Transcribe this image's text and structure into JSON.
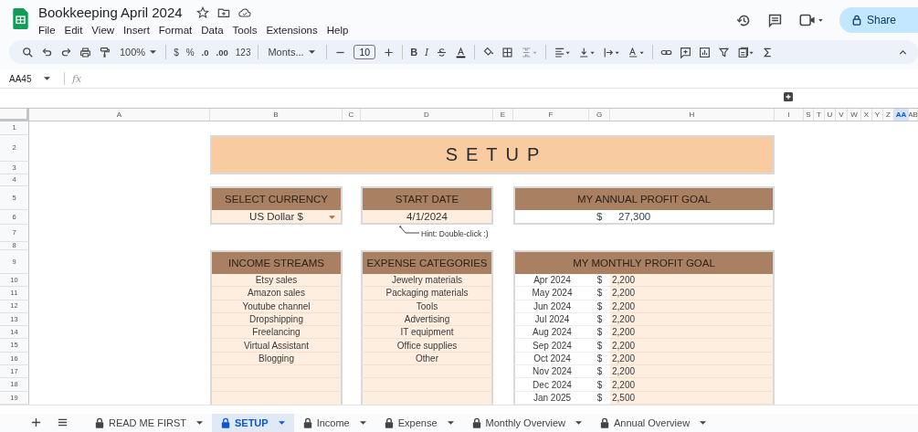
{
  "document": {
    "title": "Bookkeeping April 2024"
  },
  "menu": [
    "File",
    "Edit",
    "View",
    "Insert",
    "Format",
    "Data",
    "Tools",
    "Extensions",
    "Help"
  ],
  "share_button": {
    "label": "Share"
  },
  "toolbar": {
    "zoom": "100%",
    "currency": "$",
    "percent": "%",
    "decrease_decimals": ".0",
    "increase_decimals": ".00",
    "number_format": "123",
    "font": "Monts...",
    "font_size": "10",
    "bold": "B",
    "italic": "I"
  },
  "name_box": "AA45",
  "formula_label": "fx",
  "columns": [
    {
      "label": "A",
      "selected": false
    },
    {
      "label": "B",
      "selected": false
    },
    {
      "label": "C",
      "selected": false
    },
    {
      "label": "D",
      "selected": false
    },
    {
      "label": "E",
      "selected": false
    },
    {
      "label": "F",
      "selected": false
    },
    {
      "label": "G",
      "selected": false
    },
    {
      "label": "H",
      "selected": false
    },
    {
      "label": "I",
      "selected": false
    },
    {
      "label": "S",
      "selected": false
    },
    {
      "label": "T",
      "selected": false
    },
    {
      "label": "U",
      "selected": false
    },
    {
      "label": "V",
      "selected": false
    },
    {
      "label": "W",
      "selected": false
    },
    {
      "label": "X",
      "selected": false
    },
    {
      "label": "Y",
      "selected": false
    },
    {
      "label": "Z",
      "selected": false
    },
    {
      "label": "AA",
      "selected": true
    },
    {
      "label": "AB",
      "selected": false
    }
  ],
  "rows": [
    "1",
    "2",
    "3",
    "4",
    "5",
    "6",
    "7",
    "8",
    "9",
    "10",
    "11",
    "12",
    "13",
    "14",
    "15",
    "16",
    "17",
    "18",
    "19"
  ],
  "setup": {
    "title": "SETUP",
    "currency": {
      "heading": "SELECT CURRENCY",
      "value": "US Dollar $"
    },
    "start_date": {
      "heading": "START DATE",
      "value": "4/1/2024",
      "hint": "Hint: Double-click :)"
    },
    "annual_goal": {
      "heading": "MY ANNUAL PROFIT GOAL",
      "currency_symbol": "$",
      "amount": "27,300"
    },
    "income_streams": {
      "heading": "INCOME STREAMS",
      "items": [
        "Etsy sales",
        "Amazon sales",
        "Youtube channel",
        "Dropshipping",
        "Freelancing",
        "Virtual Assistant",
        "Blogging"
      ]
    },
    "expense_categories": {
      "heading": "EXPENSE CATEGORIES",
      "items": [
        "Jewelry materials",
        "Packaging materials",
        "Tools",
        "Advertising",
        "IT equipment",
        "Office supplies",
        "Other"
      ]
    },
    "monthly_goal": {
      "heading": "MY MONTHLY PROFIT GOAL",
      "rows": [
        {
          "month": "Apr 2024",
          "currency_symbol": "$",
          "amount": "2,200"
        },
        {
          "month": "May 2024",
          "currency_symbol": "$",
          "amount": "2,200"
        },
        {
          "month": "Jun 2024",
          "currency_symbol": "$",
          "amount": "2,200"
        },
        {
          "month": "Jul 2024",
          "currency_symbol": "$",
          "amount": "2,200"
        },
        {
          "month": "Aug 2024",
          "currency_symbol": "$",
          "amount": "2,200"
        },
        {
          "month": "Sep 2024",
          "currency_symbol": "$",
          "amount": "2,200"
        },
        {
          "month": "Oct 2024",
          "currency_symbol": "$",
          "amount": "2,200"
        },
        {
          "month": "Nov 2024",
          "currency_symbol": "$",
          "amount": "2,200"
        },
        {
          "month": "Dec 2024",
          "currency_symbol": "$",
          "amount": "2,200"
        },
        {
          "month": "Jan 2025",
          "currency_symbol": "$",
          "amount": "2,500"
        }
      ]
    }
  },
  "sheet_tabs": [
    {
      "label": "READ ME FIRST",
      "locked": true,
      "selected": false
    },
    {
      "label": "SETUP",
      "locked": true,
      "selected": true
    },
    {
      "label": "Income",
      "locked": true,
      "selected": false
    },
    {
      "label": "Expense",
      "locked": true,
      "selected": false
    },
    {
      "label": "Monthly Overview",
      "locked": true,
      "selected": false
    },
    {
      "label": "Annual Overview",
      "locked": true,
      "selected": false
    }
  ]
}
